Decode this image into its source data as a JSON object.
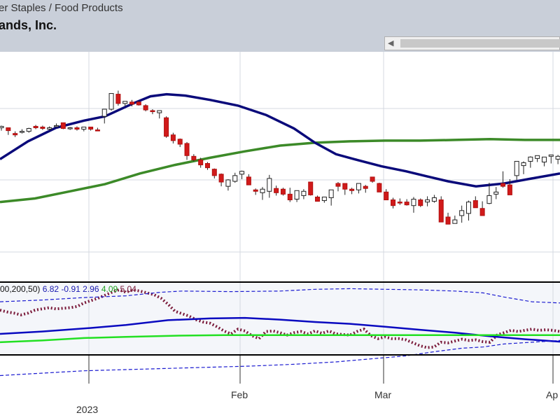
{
  "header": {
    "breadcrumb": "er Staples / Food Products",
    "company": "ands, Inc."
  },
  "scrollbar": {
    "left_arrow": "◀"
  },
  "chart_data": [
    {
      "type": "candlestick",
      "title": "",
      "ylim": [
        0,
        100
      ],
      "grid": true,
      "overlay_colors": {
        "fast": "#0a0a7a",
        "slow": "#3c8a28"
      },
      "candles": [
        [
          74,
          77,
          70,
          76
        ],
        [
          74,
          74,
          64,
          70
        ],
        [
          66,
          69,
          61,
          64
        ],
        [
          68,
          72,
          66,
          69
        ],
        [
          69,
          74,
          67,
          73
        ],
        [
          76,
          78,
          72,
          74
        ],
        [
          75,
          77,
          71,
          73
        ],
        [
          72,
          76,
          70,
          74
        ],
        [
          76,
          80,
          75,
          77
        ],
        [
          81,
          80,
          72,
          73
        ],
        [
          73,
          75,
          71,
          74
        ],
        [
          74,
          76,
          70,
          72
        ],
        [
          72,
          75,
          69,
          75
        ],
        [
          75,
          74,
          70,
          72
        ],
        [
          71,
          74,
          70,
          70
        ],
        [
          90,
          99,
          80,
          100
        ],
        [
          100,
          117,
          98,
          122
        ],
        [
          121,
          126,
          105,
          108
        ],
        [
          108,
          111,
          104,
          111
        ],
        [
          110,
          113,
          104,
          107
        ],
        [
          110,
          112,
          105,
          106
        ],
        [
          105,
          107,
          97,
          99
        ],
        [
          98,
          100,
          93,
          97
        ],
        [
          95,
          98,
          87,
          98
        ],
        [
          88,
          90,
          60,
          62
        ],
        [
          64,
          67,
          52,
          56
        ],
        [
          58,
          59,
          47,
          51
        ],
        [
          52,
          54,
          29,
          35
        ],
        [
          34,
          37,
          27,
          29
        ],
        [
          29,
          32,
          18,
          22
        ],
        [
          24,
          26,
          15,
          18
        ],
        [
          16,
          17,
          3,
          7
        ],
        [
          9,
          10,
          -8,
          -2
        ],
        [
          -8,
          2,
          -14,
          1
        ],
        [
          -1,
          11,
          -3,
          7
        ],
        [
          9,
          14,
          2,
          13
        ],
        [
          5,
          9,
          -1,
          -6
        ],
        [
          -13,
          -11,
          -20,
          -15
        ],
        [
          -17,
          -9,
          -27,
          -12
        ],
        [
          -15,
          8,
          -24,
          3
        ],
        [
          -11,
          -7,
          -21,
          -17
        ],
        [
          -12,
          -10,
          -21,
          -19
        ],
        [
          -19,
          -10,
          -30,
          -27
        ],
        [
          -26,
          -21,
          -30,
          -14
        ],
        [
          -21,
          -12,
          -26,
          -15
        ],
        [
          -2,
          -2,
          -21,
          -20
        ],
        [
          -23,
          -21,
          -24,
          -29
        ],
        [
          -28,
          -24,
          -31,
          -23
        ],
        [
          -24,
          -16,
          -35,
          -13
        ],
        [
          -4,
          -2,
          -15,
          -8
        ],
        [
          -4,
          -6,
          -20,
          -12
        ],
        [
          -12,
          -10,
          -19,
          -14
        ],
        [
          -13,
          -4,
          -18,
          -4
        ],
        [
          -8,
          -6,
          -17,
          -11
        ],
        [
          5,
          5,
          -3,
          -1
        ],
        [
          -4,
          -3,
          -13,
          -16
        ],
        [
          -16,
          -12,
          -26,
          -27
        ],
        [
          -27,
          -24,
          -39,
          -35
        ],
        [
          -30,
          -25,
          -34,
          -31
        ],
        [
          -30,
          -26,
          -35,
          -34
        ],
        [
          -35,
          -23,
          -45,
          -26
        ],
        [
          -27,
          -25,
          -37,
          -35
        ],
        [
          -30,
          -22,
          -36,
          -27
        ],
        [
          -29,
          -20,
          -31,
          -24
        ],
        [
          -27,
          -22,
          -48,
          -58
        ],
        [
          -51,
          -45,
          -59,
          -61
        ],
        [
          -60,
          -49,
          -60,
          -55
        ],
        [
          -49,
          -35,
          -59,
          -42
        ],
        [
          -46,
          -28,
          -56,
          -30
        ],
        [
          -28,
          -22,
          -32,
          -38
        ],
        [
          -39,
          -29,
          -44,
          -49
        ],
        [
          -32,
          -3,
          -33,
          -21
        ],
        [
          -19,
          -9,
          -26,
          -16
        ],
        [
          -4,
          13,
          -10,
          -8
        ],
        [
          -6,
          2,
          -15,
          -20
        ],
        [
          7,
          22,
          1,
          27
        ],
        [
          21,
          27,
          9,
          25
        ],
        [
          27,
          34,
          18,
          33
        ],
        [
          31,
          35,
          26,
          35
        ],
        [
          26,
          32,
          20,
          33
        ],
        [
          34,
          32,
          24,
          36
        ],
        [
          30,
          36,
          23,
          34
        ]
      ],
      "fast_ma": [
        [
          0,
          30
        ],
        [
          40,
          55
        ],
        [
          80,
          74
        ],
        [
          120,
          84
        ],
        [
          150,
          90
        ],
        [
          190,
          108
        ],
        [
          215,
          118
        ],
        [
          238,
          121
        ],
        [
          265,
          119
        ],
        [
          300,
          113
        ],
        [
          340,
          105
        ],
        [
          380,
          92
        ],
        [
          420,
          73
        ],
        [
          450,
          53
        ],
        [
          480,
          37
        ],
        [
          510,
          29
        ],
        [
          545,
          20
        ],
        [
          580,
          13
        ],
        [
          610,
          6
        ],
        [
          640,
          -1
        ],
        [
          680,
          -8
        ],
        [
          720,
          -4
        ],
        [
          760,
          3
        ],
        [
          800,
          10
        ]
      ],
      "slow_ma": [
        [
          0,
          -30
        ],
        [
          50,
          -25
        ],
        [
          100,
          -15
        ],
        [
          150,
          -5
        ],
        [
          200,
          10
        ],
        [
          250,
          22
        ],
        [
          300,
          32
        ],
        [
          350,
          41
        ],
        [
          400,
          49
        ],
        [
          450,
          53
        ],
        [
          500,
          55
        ],
        [
          550,
          56
        ],
        [
          600,
          56
        ],
        [
          650,
          57
        ],
        [
          700,
          58
        ],
        [
          750,
          57
        ],
        [
          800,
          57
        ]
      ]
    },
    {
      "type": "line",
      "ylim": [
        0,
        100
      ],
      "legend": "top-left",
      "params_label": "00,200,50)",
      "values": [
        "6.82",
        "-0.91",
        "2.96",
        "4.09",
        "5.04"
      ],
      "value_colors": [
        "#1a1ab0",
        "#1a1ab0",
        "#1a1ab0",
        "#1fa01f",
        "#7a1a3a"
      ],
      "series": [
        {
          "style": "dotted",
          "color": "#7a1a3a",
          "x": [
            0,
            10,
            20,
            30,
            40,
            50,
            60,
            70,
            80,
            90,
            100,
            110,
            120,
            130,
            140,
            150,
            160,
            170,
            180,
            190,
            200,
            210,
            220,
            230,
            240,
            250,
            260,
            270,
            280,
            290,
            300,
            310,
            320,
            330,
            340,
            350,
            360,
            370,
            380,
            390,
            400,
            410,
            420,
            430,
            440,
            450,
            460,
            470,
            480,
            490,
            500,
            510,
            520,
            530,
            540,
            550,
            560,
            570,
            580,
            590,
            600,
            610,
            620,
            630,
            640,
            650,
            660,
            670,
            680,
            690,
            700,
            710,
            720,
            730,
            740,
            750,
            760,
            770,
            780,
            790,
            800
          ],
          "y": [
            60,
            57,
            55,
            52,
            55,
            60,
            62,
            64,
            62,
            63,
            64,
            66,
            72,
            76,
            80,
            85,
            90,
            94,
            90,
            94,
            92,
            89,
            86,
            80,
            70,
            58,
            54,
            50,
            44,
            40,
            38,
            32,
            25,
            20,
            28,
            25,
            17,
            12,
            24,
            25,
            22,
            18,
            22,
            24,
            20,
            25,
            21,
            25,
            20,
            19,
            18,
            24,
            28,
            17,
            12,
            15,
            12,
            12,
            10,
            5,
            0,
            -3,
            -2,
            6,
            5,
            8,
            11,
            9,
            10,
            7,
            6,
            18,
            22,
            26,
            24,
            26,
            28,
            26,
            27,
            26,
            24
          ]
        },
        {
          "style": "solid",
          "color": "#0a0ac0",
          "x": [
            0,
            60,
            130,
            180,
            240,
            300,
            350,
            400,
            450,
            500,
            550,
            600,
            650,
            700,
            750,
            800
          ],
          "y": [
            20,
            24,
            30,
            35,
            43,
            46,
            47,
            44,
            40,
            37,
            32,
            27,
            22,
            16,
            11,
            7
          ]
        },
        {
          "style": "solid",
          "color": "#22e022",
          "x": [
            0,
            60,
            120,
            180,
            250,
            320,
            400,
            500,
            600,
            700,
            800
          ],
          "y": [
            6,
            9,
            13,
            15,
            17,
            18,
            18,
            18,
            18,
            18,
            18
          ]
        },
        {
          "style": "dashed",
          "color": "#1a1ad0",
          "x": [
            0,
            60,
            120,
            180,
            230,
            260,
            330,
            400,
            450,
            500,
            550,
            600,
            650,
            690,
            720,
            760,
            800
          ],
          "y": [
            74,
            77,
            81,
            84,
            90,
            92,
            91,
            92,
            95,
            96,
            95,
            94,
            92,
            89,
            82,
            74,
            72
          ]
        },
        {
          "style": "dashed",
          "color": "#1a1ad0",
          "x": [
            0,
            60,
            120,
            180,
            240,
            300,
            360,
            420,
            480,
            520,
            580,
            620,
            660,
            690,
            720,
            760,
            800
          ],
          "y": [
            -50,
            -46,
            -42,
            -40,
            -38,
            -36,
            -34,
            -31,
            -27,
            -23,
            -17,
            -10,
            -4,
            -2,
            3,
            6,
            9
          ]
        }
      ]
    }
  ],
  "x_axis": {
    "labels": [
      "Feb",
      "Mar",
      "Ap"
    ],
    "label_values": [
      343,
      548,
      790
    ],
    "year_label": "2023",
    "year_value": 127
  }
}
